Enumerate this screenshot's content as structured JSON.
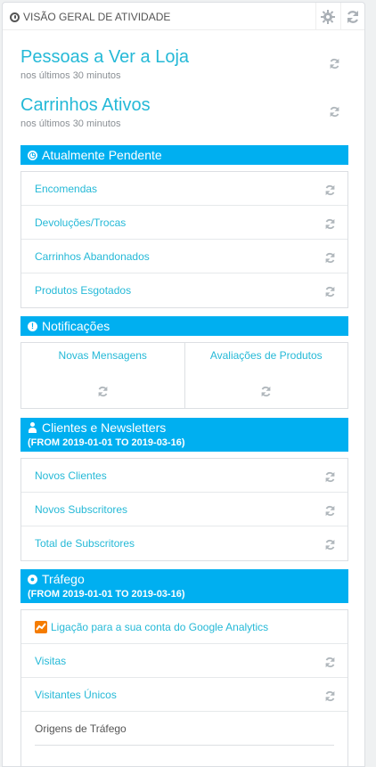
{
  "header": {
    "title": "VISÃO GERAL DE ATIVIDADE",
    "config_icon": "gear-icon",
    "refresh_icon": "refresh-icon"
  },
  "metrics": [
    {
      "title": "Pessoas a Ver a Loja",
      "subtitle": "nos últimos 30 minutos"
    },
    {
      "title": "Carrinhos Ativos",
      "subtitle": "nos últimos 30 minutos"
    }
  ],
  "pending": {
    "title": "Atualmente Pendente",
    "icon": "clock-icon",
    "items": [
      "Encomendas",
      "Devoluções/Trocas",
      "Carrinhos Abandonados",
      "Produtos Esgotados"
    ]
  },
  "notifications": {
    "title": "Notificações",
    "icon": "exclamation-icon",
    "columns": [
      "Novas Mensagens",
      "Avaliações de Produtos"
    ]
  },
  "customers": {
    "title": "Clientes e Newsletters",
    "range": "(FROM 2019-01-01 TO 2019-03-16)",
    "icon": "user-icon",
    "items": [
      "Novos Clientes",
      "Novos Subscritores",
      "Total de Subscritores"
    ]
  },
  "traffic": {
    "title": "Tráfego",
    "range": "(FROM 2019-01-01 TO 2019-03-16)",
    "icon": "globe-icon",
    "analytics_link": "Ligação para a sua conta do Google Analytics",
    "items": [
      "Visitas",
      "Visitantes Únicos"
    ],
    "sources_label": "Origens de Tráfego"
  },
  "colors": {
    "accent": "#00aff0",
    "link": "#25b9d7"
  }
}
